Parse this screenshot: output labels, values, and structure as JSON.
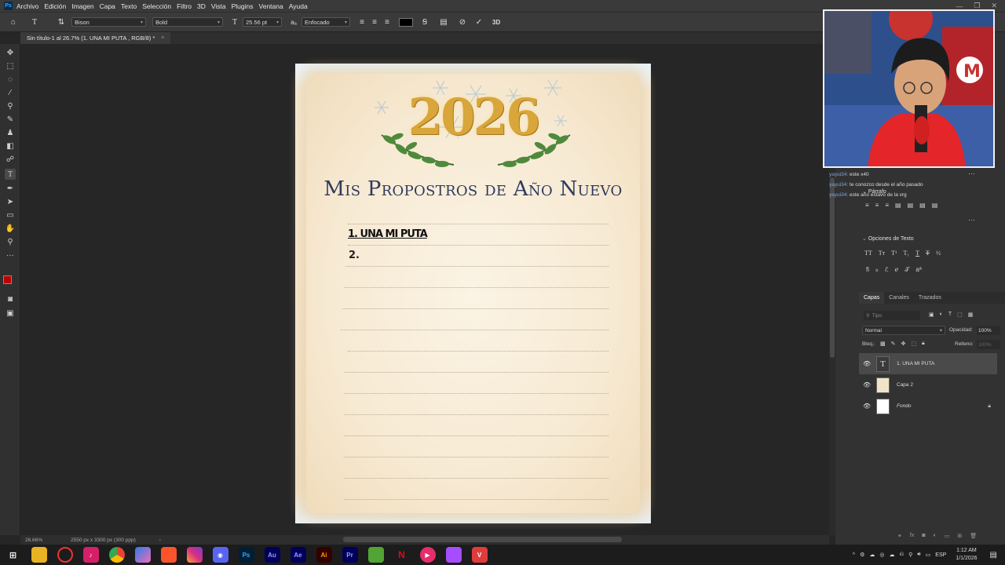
{
  "menubar": {
    "logo": "Ps",
    "items": [
      "Archivo",
      "Edición",
      "Imagen",
      "Capa",
      "Texto",
      "Selección",
      "Filtro",
      "3D",
      "Vista",
      "Plugins",
      "Ventana",
      "Ayuda"
    ]
  },
  "options": {
    "font_family": "Bison",
    "font_style": "Bold",
    "font_size": "25.56 pt",
    "antialias": "Enfocado",
    "text_color": "#000000",
    "label_3d": "3D"
  },
  "document": {
    "tab_title": "Sin título-1 al 26.7% (1. UNA MI PUTA , RGB/8) *",
    "year": "2026",
    "heading": "Mis Propostros de Año Nuevo",
    "line1": "1. UNA MI PUTA",
    "line2": "2."
  },
  "status": {
    "zoom": "26.66%",
    "doc_size": "2550 px x 3300 px (300 ppp)"
  },
  "chat": [
    {
      "user": "yayui34:",
      "text": "este x40"
    },
    {
      "user": "yayui34:",
      "text": "te conozco desde el año pasado"
    },
    {
      "user": "yayui34:",
      "text": "este año estavo de la vrg"
    }
  ],
  "panels": {
    "paragraph": "Párrafo",
    "text_options": "Opciones de Texto",
    "tabs": [
      "Capas",
      "Canales",
      "Trazados"
    ],
    "filter_placeholder": "Tipo",
    "blend_mode": "Normal",
    "opacity_label": "Opacidad:",
    "opacity": "100%",
    "lock_label": "Bloq.:",
    "fill_label": "Relleno:",
    "fill": "100%"
  },
  "layers": [
    {
      "name": "1. UNA MI PUTA",
      "type": "text",
      "selected": true
    },
    {
      "name": "Capa 2",
      "type": "image",
      "selected": false
    },
    {
      "name": "Fondo",
      "type": "background",
      "selected": false,
      "locked": true
    }
  ],
  "taskbar": {
    "apps": [
      "Ps",
      "Au",
      "Ae",
      "Ai",
      "Pr"
    ],
    "language": "ESP",
    "time": "1:12 AM",
    "date": "1/1/2026"
  }
}
